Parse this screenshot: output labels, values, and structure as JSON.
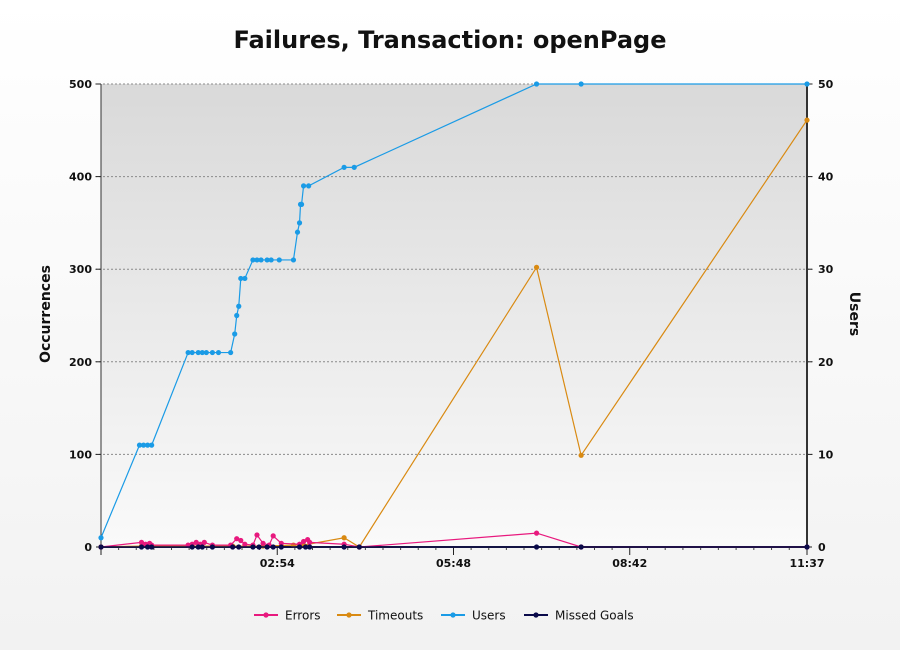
{
  "chart_data": {
    "type": "line",
    "title": "Failures, Transaction: openPage",
    "xlabel": "",
    "ylabel": "Occurrences",
    "y2label": "Users",
    "x_ticks": [
      "02:54",
      "05:48",
      "08:42",
      "11:37"
    ],
    "x_tick_seconds": [
      174,
      348,
      522,
      697
    ],
    "xlim_seconds": [
      0,
      697
    ],
    "ylim": [
      0,
      500
    ],
    "y_ticks": [
      0,
      100,
      200,
      300,
      400,
      500
    ],
    "y2lim": [
      0,
      50
    ],
    "y2_ticks": [
      0,
      10,
      20,
      30,
      40,
      50
    ],
    "grid": true,
    "legend_position": "bottom",
    "colors": {
      "errors": "#e8197e",
      "timeouts": "#d98a12",
      "users": "#1a9be6",
      "missed_goals": "#0a0a4a"
    },
    "series": [
      {
        "name": "Errors",
        "key": "errors",
        "axis": "left",
        "x": [
          0,
          40,
          44,
          48,
          50,
          86,
          90,
          94,
          98,
          102,
          110,
          128,
          134,
          138,
          142,
          150,
          154,
          160,
          166,
          170,
          178,
          196,
          200,
          204,
          206,
          240,
          255,
          430,
          474,
          697
        ],
        "y": [
          0,
          5,
          3,
          4,
          2,
          2,
          3,
          5,
          3,
          5,
          2,
          2,
          9,
          7,
          3,
          2,
          13,
          4,
          2,
          12,
          4,
          3,
          6,
          8,
          5,
          3,
          0,
          15,
          0,
          0
        ]
      },
      {
        "name": "Timeouts",
        "key": "timeouts",
        "axis": "left",
        "x": [
          0,
          40,
          90,
          130,
          160,
          190,
          200,
          240,
          255,
          430,
          474,
          697
        ],
        "y": [
          0,
          1,
          1,
          1,
          1,
          2,
          2,
          10,
          0,
          302,
          99,
          461
        ]
      },
      {
        "name": "Users",
        "key": "users",
        "axis": "right",
        "x": [
          0,
          38,
          42,
          46,
          50,
          86,
          90,
          96,
          100,
          104,
          110,
          116,
          128,
          132,
          134,
          136,
          138,
          142,
          150,
          154,
          158,
          164,
          168,
          176,
          190,
          194,
          196,
          197,
          198,
          200,
          205,
          240,
          250,
          430,
          474,
          697
        ],
        "y": [
          1,
          11,
          11,
          11,
          11,
          21,
          21,
          21,
          21,
          21,
          21,
          21,
          21,
          23,
          25,
          26,
          29,
          29,
          31,
          31,
          31,
          31,
          31,
          31,
          31,
          34,
          35,
          37,
          37,
          39,
          39,
          41,
          41,
          50,
          50,
          50
        ]
      },
      {
        "name": "Missed Goals",
        "key": "missed_goals",
        "axis": "left",
        "x": [
          0,
          40,
          46,
          50,
          90,
          96,
          100,
          110,
          130,
          136,
          150,
          156,
          164,
          170,
          178,
          196,
          202,
          206,
          240,
          255,
          430,
          474,
          697
        ],
        "y": [
          0,
          0,
          0,
          0,
          0,
          0,
          0,
          0,
          0,
          0,
          0,
          0,
          0,
          0,
          0,
          0,
          0,
          0,
          0,
          0,
          0,
          0,
          0
        ]
      }
    ]
  }
}
